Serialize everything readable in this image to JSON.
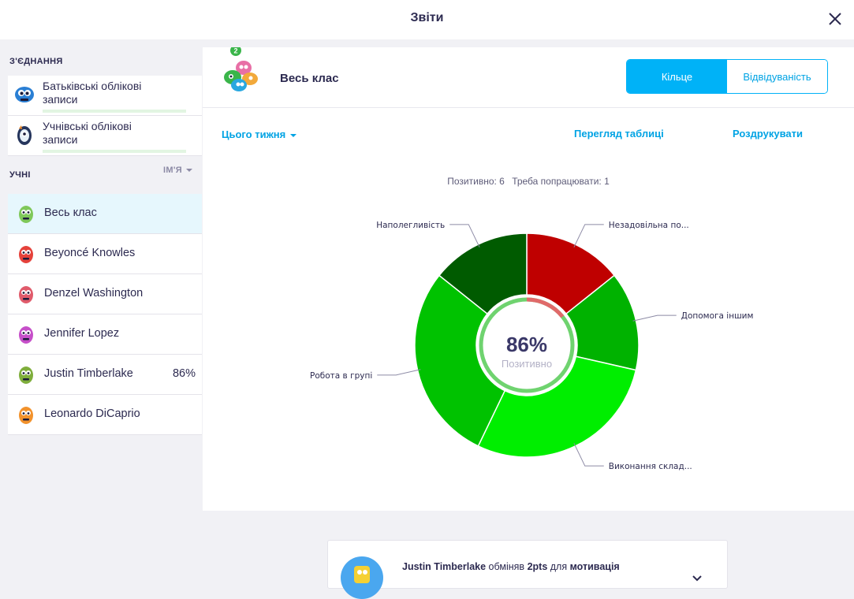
{
  "header": {
    "title": "Звіти",
    "close_icon": "close-icon"
  },
  "sidebar": {
    "connections_heading": "З'ЄДНАННЯ",
    "connections": [
      {
        "label": "Батьківські облікові записи",
        "icon": "monster-blue-icon"
      },
      {
        "label": "Учнівські облікові записи",
        "icon": "monster-navy-icon"
      }
    ],
    "students_heading": "УЧНІ",
    "sort_label": "ІМ'Я",
    "students": [
      {
        "name": "Весь клас",
        "pct": "",
        "color": "#7fc85a",
        "active": true
      },
      {
        "name": "Beyoncé Knowles",
        "pct": "",
        "color": "#e5423b"
      },
      {
        "name": "Denzel Washington",
        "pct": "",
        "color": "#e05b6b"
      },
      {
        "name": "Jennifer Lopez",
        "pct": "",
        "color": "#c64fc9"
      },
      {
        "name": "Justin Timberlake",
        "pct": "86%",
        "color": "#7fae3c"
      },
      {
        "name": "Leonardo DiCaprio",
        "pct": "",
        "color": "#f2922c"
      }
    ]
  },
  "main": {
    "class_title": "Весь клас",
    "badge": "2",
    "view_toggle": {
      "ring": "Кільце",
      "attendance": "Відвідуваність"
    },
    "period": "Цього тижня",
    "table_view": "Перегляд таблиці",
    "print": "Роздрукувати",
    "summary": {
      "positive": "Позитивно: 6",
      "needs_work": "Треба попрацювати: 1"
    }
  },
  "chart_data": {
    "type": "pie",
    "style": "donut",
    "center_value": "86%",
    "center_label": "Позитивно",
    "slices": [
      {
        "label": "Незадовільна по...",
        "value": 1,
        "color": "#bf0000"
      },
      {
        "label": "Допомога іншим",
        "value": 1,
        "color": "#00b200"
      },
      {
        "label": "Виконання склад...",
        "value": 2,
        "color": "#00ee00"
      },
      {
        "label": "Робота в групі",
        "value": 2,
        "color": "#00c200"
      },
      {
        "label": "Наполегливість",
        "value": 1,
        "color": "#005b00"
      }
    ]
  },
  "feed": {
    "name": "Justin Timberlake",
    "verb": "обміняв",
    "points": "2pts",
    "prep": "для",
    "reward": "мотивація"
  }
}
